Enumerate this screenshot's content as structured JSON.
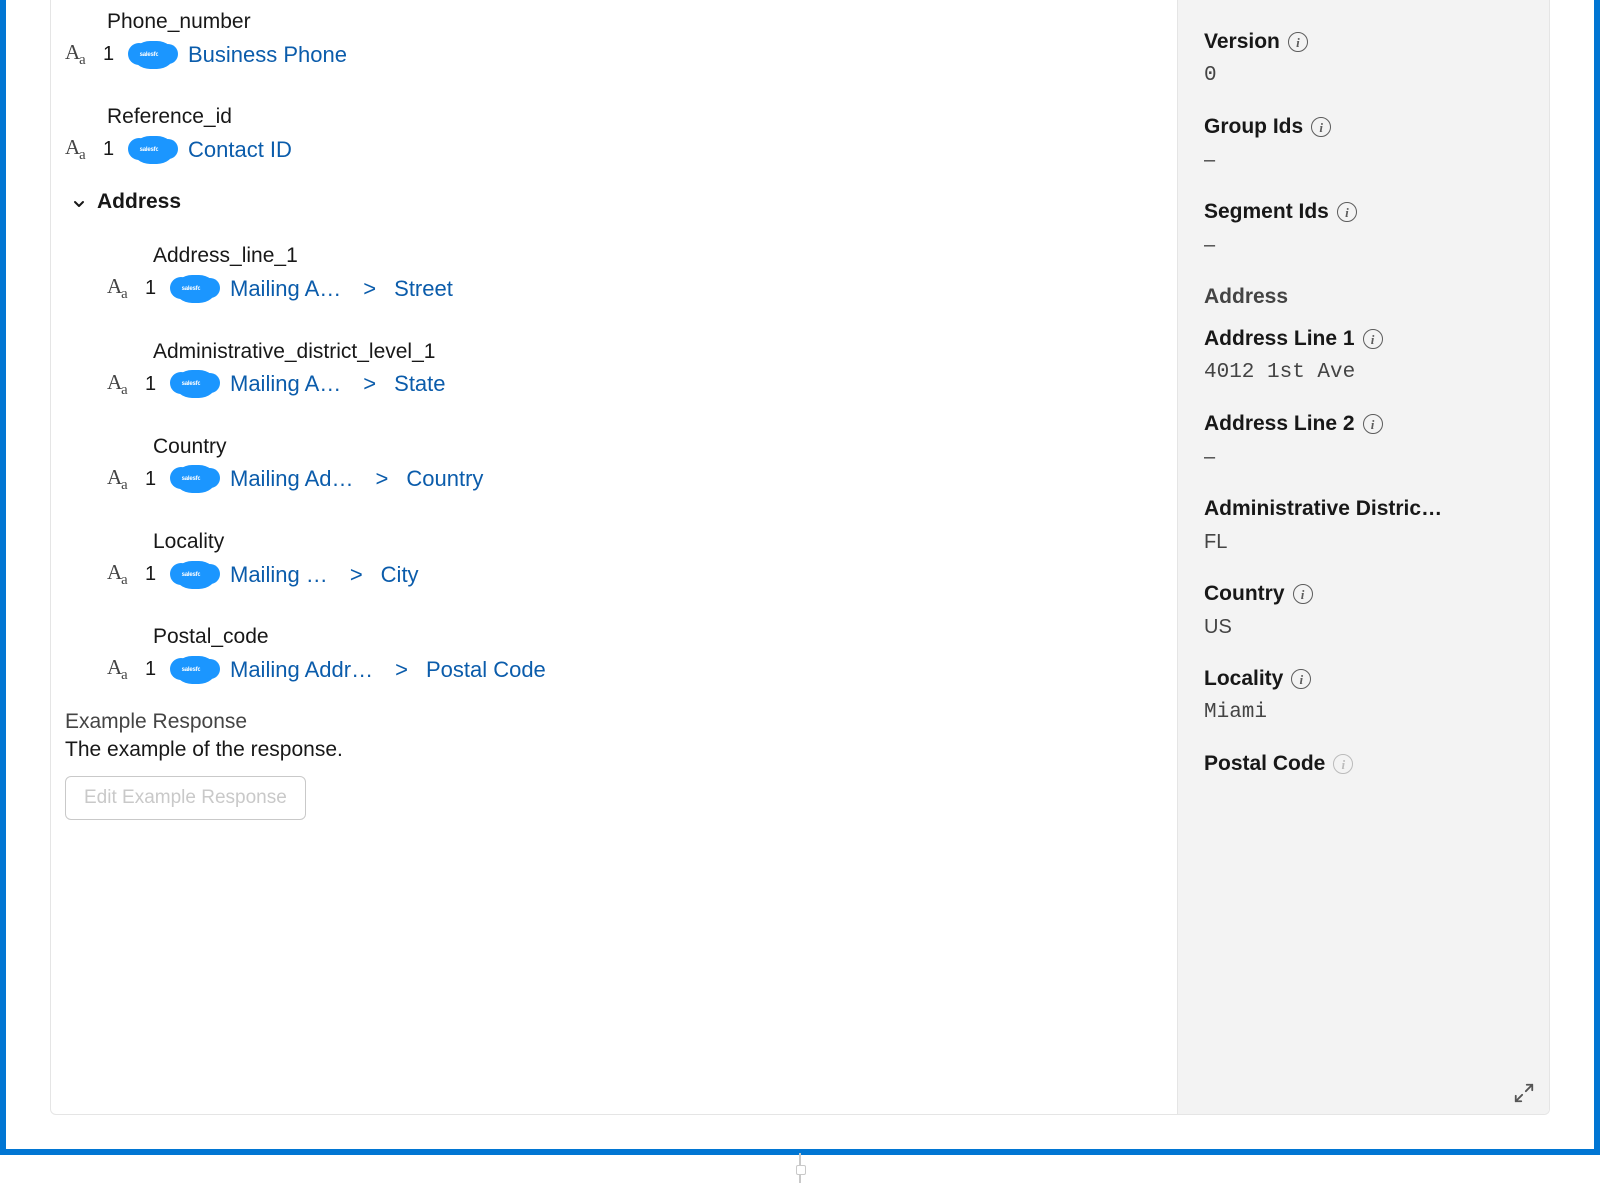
{
  "fields": {
    "phone_number": {
      "name": "Phone_number",
      "mapped": "Business Phone"
    },
    "reference_id": {
      "name": "Reference_id",
      "mapped": "Contact ID"
    }
  },
  "addressGroup": {
    "title": "Address",
    "fields": {
      "line1": {
        "name": "Address_line_1",
        "path1": "Mailing A…",
        "path2": "Street"
      },
      "admin": {
        "name": "Administrative_district_level_1",
        "path1": "Mailing A…",
        "path2": "State"
      },
      "country": {
        "name": "Country",
        "path1": "Mailing Ad…",
        "path2": "Country"
      },
      "locality": {
        "name": "Locality",
        "path1": "Mailing …",
        "path2": "City"
      },
      "postal": {
        "name": "Postal_code",
        "path1": "Mailing Addr…",
        "path2": "Postal Code"
      }
    }
  },
  "index": "1",
  "sfText": "salesforce",
  "example": {
    "title": "Example Response",
    "desc": "The example of the response.",
    "button": "Edit Example Response"
  },
  "sidebar": {
    "version": {
      "label": "Version",
      "value": "0"
    },
    "groupIds": {
      "label": "Group Ids",
      "value": "–"
    },
    "segmentIds": {
      "label": "Segment Ids",
      "value": "–"
    },
    "addressSection": "Address",
    "addr1": {
      "label": "Address Line 1",
      "value": "4012 1st Ave"
    },
    "addr2": {
      "label": "Address Line 2",
      "value": "–"
    },
    "admin": {
      "label": "Administrative Distric…",
      "value": "FL"
    },
    "country": {
      "label": "Country",
      "value": "US"
    },
    "locality": {
      "label": "Locality",
      "value": "Miami"
    },
    "postal": {
      "label": "Postal Code"
    }
  }
}
